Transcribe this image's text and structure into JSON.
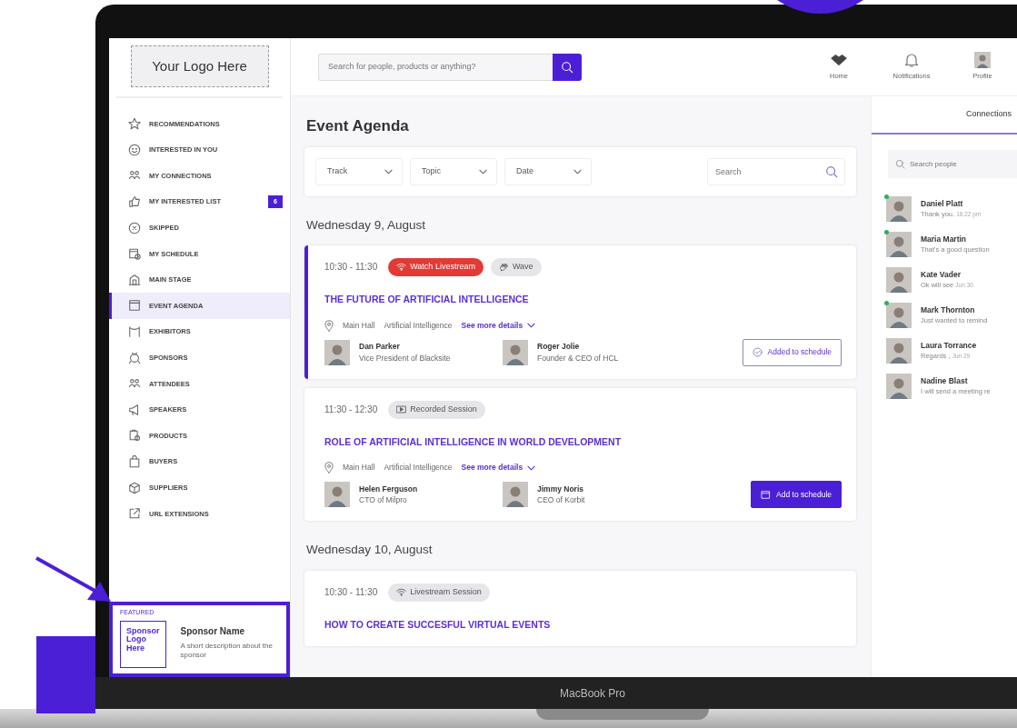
{
  "logo": {
    "text": "Your Logo Here"
  },
  "sidebar": {
    "items": [
      {
        "label": "RECOMMENDATIONS",
        "selected": false
      },
      {
        "label": "INTERESTED IN YOU",
        "selected": false
      },
      {
        "label": "MY CONNECTIONS",
        "selected": false
      },
      {
        "label": "MY INTERESTED LIST",
        "selected": false,
        "badge": "6"
      },
      {
        "label": "SKIPPED",
        "selected": false
      },
      {
        "label": "MY SCHEDULE",
        "selected": false
      },
      {
        "label": "MAIN STAGE",
        "selected": false
      },
      {
        "label": "EVENT AGENDA",
        "selected": true
      },
      {
        "label": "EXHIBITORS",
        "selected": false
      },
      {
        "label": "SPONSORS",
        "selected": false
      },
      {
        "label": "ATTENDEES",
        "selected": false
      },
      {
        "label": "SPEAKERS",
        "selected": false
      },
      {
        "label": "PRODUCTS",
        "selected": false
      },
      {
        "label": "BUYERS",
        "selected": false
      },
      {
        "label": "SUPPLIERS",
        "selected": false
      },
      {
        "label": "URL EXTENSIONS",
        "selected": false
      }
    ]
  },
  "featured": {
    "heading": "FEATURED",
    "logo_text": "Sponsor Logo Here",
    "name": "Sponsor Name",
    "description": "A short description about the sponsor"
  },
  "topbar": {
    "search_placeholder": "Search for people, products or anything?",
    "nav": [
      {
        "kind": "home",
        "label": "Home"
      },
      {
        "kind": "bell",
        "label": "Notifications"
      },
      {
        "kind": "avatar",
        "label": "Profile"
      }
    ]
  },
  "agenda": {
    "title": "Event Agenda",
    "filters": [
      {
        "label": "Track"
      },
      {
        "label": "Topic"
      },
      {
        "label": "Date"
      }
    ],
    "search_placeholder": "Search",
    "days": [
      {
        "date": "Wednesday 9, August",
        "sessions": [
          {
            "highlighted": true,
            "time": "10:30 - 11:30",
            "tags": [
              {
                "kind": "live",
                "label": "Watch Livestream"
              },
              {
                "kind": "wave",
                "label": "Wave"
              }
            ],
            "title": "THE FUTURE OF ARTIFICIAL INTELLIGENCE",
            "location": "Main Hall",
            "topic": "Artificial Intelligence",
            "details_link": "See more details",
            "speakers": [
              {
                "name": "Dan Parker",
                "role": "Vice President of Blacksite"
              },
              {
                "name": "Roger Jolie",
                "role": "Founder & CEO of HCL"
              }
            ],
            "action": {
              "label": "Added to schedule",
              "added": true
            }
          },
          {
            "highlighted": false,
            "time": "11:30 - 12:30",
            "tags": [
              {
                "kind": "recorded",
                "label": "Recorded Session"
              }
            ],
            "title": "ROLE OF ARTIFICIAL INTELLIGENCE IN WORLD DEVELOPMENT",
            "location": "Main Hall",
            "topic": "Artificial Intelligence",
            "details_link": "See more details",
            "speakers": [
              {
                "name": "Helen Ferguson",
                "role": "CTO of Milpro"
              },
              {
                "name": "Jimmy Noris",
                "role": "CEO of Korbit"
              }
            ],
            "action": {
              "label": "Add to schedule",
              "added": false
            }
          }
        ]
      },
      {
        "date": "Wednesday 10, August",
        "sessions": [
          {
            "highlighted": false,
            "time": "10:30 - 11:30",
            "tags": [
              {
                "kind": "stream",
                "label": "Livestream Session"
              }
            ],
            "title": "HOW TO CREATE SUCCESFUL VIRTUAL EVENTS"
          }
        ]
      }
    ]
  },
  "connections": {
    "tabs": [
      {
        "label": "Connections",
        "selected": true
      }
    ],
    "search_placeholder": "Search people",
    "contacts": [
      {
        "name": "Daniel Platt",
        "message": "Thank you.",
        "time": "16:22 pm",
        "online": true
      },
      {
        "name": "Maria Martin",
        "message": "That's a good question",
        "online": true
      },
      {
        "name": "Kate Vader",
        "message": "Ok will see",
        "time": "Jun 30",
        "online": false
      },
      {
        "name": "Mark Thornton",
        "message": "Just wanted to remind",
        "online": true
      },
      {
        "name": "Laura Torrance",
        "message": "Regards ,",
        "time": "Jun 29",
        "online": false
      },
      {
        "name": "Nadine Blast",
        "message": "I will send a meeting re",
        "online": false
      }
    ]
  },
  "device_label": "MacBook Pro"
}
